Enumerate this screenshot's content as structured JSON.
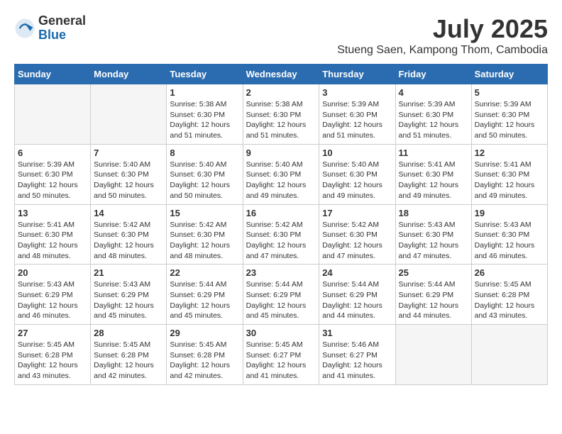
{
  "logo": {
    "general": "General",
    "blue": "Blue"
  },
  "title": {
    "month_year": "July 2025",
    "location": "Stueng Saen, Kampong Thom, Cambodia"
  },
  "headers": [
    "Sunday",
    "Monday",
    "Tuesday",
    "Wednesday",
    "Thursday",
    "Friday",
    "Saturday"
  ],
  "weeks": [
    [
      {
        "day": "",
        "sunrise": "",
        "sunset": "",
        "daylight": "",
        "empty": true
      },
      {
        "day": "",
        "sunrise": "",
        "sunset": "",
        "daylight": "",
        "empty": true
      },
      {
        "day": "1",
        "sunrise": "Sunrise: 5:38 AM",
        "sunset": "Sunset: 6:30 PM",
        "daylight": "Daylight: 12 hours and 51 minutes."
      },
      {
        "day": "2",
        "sunrise": "Sunrise: 5:38 AM",
        "sunset": "Sunset: 6:30 PM",
        "daylight": "Daylight: 12 hours and 51 minutes."
      },
      {
        "day": "3",
        "sunrise": "Sunrise: 5:39 AM",
        "sunset": "Sunset: 6:30 PM",
        "daylight": "Daylight: 12 hours and 51 minutes."
      },
      {
        "day": "4",
        "sunrise": "Sunrise: 5:39 AM",
        "sunset": "Sunset: 6:30 PM",
        "daylight": "Daylight: 12 hours and 51 minutes."
      },
      {
        "day": "5",
        "sunrise": "Sunrise: 5:39 AM",
        "sunset": "Sunset: 6:30 PM",
        "daylight": "Daylight: 12 hours and 50 minutes."
      }
    ],
    [
      {
        "day": "6",
        "sunrise": "Sunrise: 5:39 AM",
        "sunset": "Sunset: 6:30 PM",
        "daylight": "Daylight: 12 hours and 50 minutes."
      },
      {
        "day": "7",
        "sunrise": "Sunrise: 5:40 AM",
        "sunset": "Sunset: 6:30 PM",
        "daylight": "Daylight: 12 hours and 50 minutes."
      },
      {
        "day": "8",
        "sunrise": "Sunrise: 5:40 AM",
        "sunset": "Sunset: 6:30 PM",
        "daylight": "Daylight: 12 hours and 50 minutes."
      },
      {
        "day": "9",
        "sunrise": "Sunrise: 5:40 AM",
        "sunset": "Sunset: 6:30 PM",
        "daylight": "Daylight: 12 hours and 49 minutes."
      },
      {
        "day": "10",
        "sunrise": "Sunrise: 5:40 AM",
        "sunset": "Sunset: 6:30 PM",
        "daylight": "Daylight: 12 hours and 49 minutes."
      },
      {
        "day": "11",
        "sunrise": "Sunrise: 5:41 AM",
        "sunset": "Sunset: 6:30 PM",
        "daylight": "Daylight: 12 hours and 49 minutes."
      },
      {
        "day": "12",
        "sunrise": "Sunrise: 5:41 AM",
        "sunset": "Sunset: 6:30 PM",
        "daylight": "Daylight: 12 hours and 49 minutes."
      }
    ],
    [
      {
        "day": "13",
        "sunrise": "Sunrise: 5:41 AM",
        "sunset": "Sunset: 6:30 PM",
        "daylight": "Daylight: 12 hours and 48 minutes."
      },
      {
        "day": "14",
        "sunrise": "Sunrise: 5:42 AM",
        "sunset": "Sunset: 6:30 PM",
        "daylight": "Daylight: 12 hours and 48 minutes."
      },
      {
        "day": "15",
        "sunrise": "Sunrise: 5:42 AM",
        "sunset": "Sunset: 6:30 PM",
        "daylight": "Daylight: 12 hours and 48 minutes."
      },
      {
        "day": "16",
        "sunrise": "Sunrise: 5:42 AM",
        "sunset": "Sunset: 6:30 PM",
        "daylight": "Daylight: 12 hours and 47 minutes."
      },
      {
        "day": "17",
        "sunrise": "Sunrise: 5:42 AM",
        "sunset": "Sunset: 6:30 PM",
        "daylight": "Daylight: 12 hours and 47 minutes."
      },
      {
        "day": "18",
        "sunrise": "Sunrise: 5:43 AM",
        "sunset": "Sunset: 6:30 PM",
        "daylight": "Daylight: 12 hours and 47 minutes."
      },
      {
        "day": "19",
        "sunrise": "Sunrise: 5:43 AM",
        "sunset": "Sunset: 6:30 PM",
        "daylight": "Daylight: 12 hours and 46 minutes."
      }
    ],
    [
      {
        "day": "20",
        "sunrise": "Sunrise: 5:43 AM",
        "sunset": "Sunset: 6:29 PM",
        "daylight": "Daylight: 12 hours and 46 minutes."
      },
      {
        "day": "21",
        "sunrise": "Sunrise: 5:43 AM",
        "sunset": "Sunset: 6:29 PM",
        "daylight": "Daylight: 12 hours and 45 minutes."
      },
      {
        "day": "22",
        "sunrise": "Sunrise: 5:44 AM",
        "sunset": "Sunset: 6:29 PM",
        "daylight": "Daylight: 12 hours and 45 minutes."
      },
      {
        "day": "23",
        "sunrise": "Sunrise: 5:44 AM",
        "sunset": "Sunset: 6:29 PM",
        "daylight": "Daylight: 12 hours and 45 minutes."
      },
      {
        "day": "24",
        "sunrise": "Sunrise: 5:44 AM",
        "sunset": "Sunset: 6:29 PM",
        "daylight": "Daylight: 12 hours and 44 minutes."
      },
      {
        "day": "25",
        "sunrise": "Sunrise: 5:44 AM",
        "sunset": "Sunset: 6:29 PM",
        "daylight": "Daylight: 12 hours and 44 minutes."
      },
      {
        "day": "26",
        "sunrise": "Sunrise: 5:45 AM",
        "sunset": "Sunset: 6:28 PM",
        "daylight": "Daylight: 12 hours and 43 minutes."
      }
    ],
    [
      {
        "day": "27",
        "sunrise": "Sunrise: 5:45 AM",
        "sunset": "Sunset: 6:28 PM",
        "daylight": "Daylight: 12 hours and 43 minutes."
      },
      {
        "day": "28",
        "sunrise": "Sunrise: 5:45 AM",
        "sunset": "Sunset: 6:28 PM",
        "daylight": "Daylight: 12 hours and 42 minutes."
      },
      {
        "day": "29",
        "sunrise": "Sunrise: 5:45 AM",
        "sunset": "Sunset: 6:28 PM",
        "daylight": "Daylight: 12 hours and 42 minutes."
      },
      {
        "day": "30",
        "sunrise": "Sunrise: 5:45 AM",
        "sunset": "Sunset: 6:27 PM",
        "daylight": "Daylight: 12 hours and 41 minutes."
      },
      {
        "day": "31",
        "sunrise": "Sunrise: 5:46 AM",
        "sunset": "Sunset: 6:27 PM",
        "daylight": "Daylight: 12 hours and 41 minutes."
      },
      {
        "day": "",
        "sunrise": "",
        "sunset": "",
        "daylight": "",
        "empty": true
      },
      {
        "day": "",
        "sunrise": "",
        "sunset": "",
        "daylight": "",
        "empty": true
      }
    ]
  ]
}
